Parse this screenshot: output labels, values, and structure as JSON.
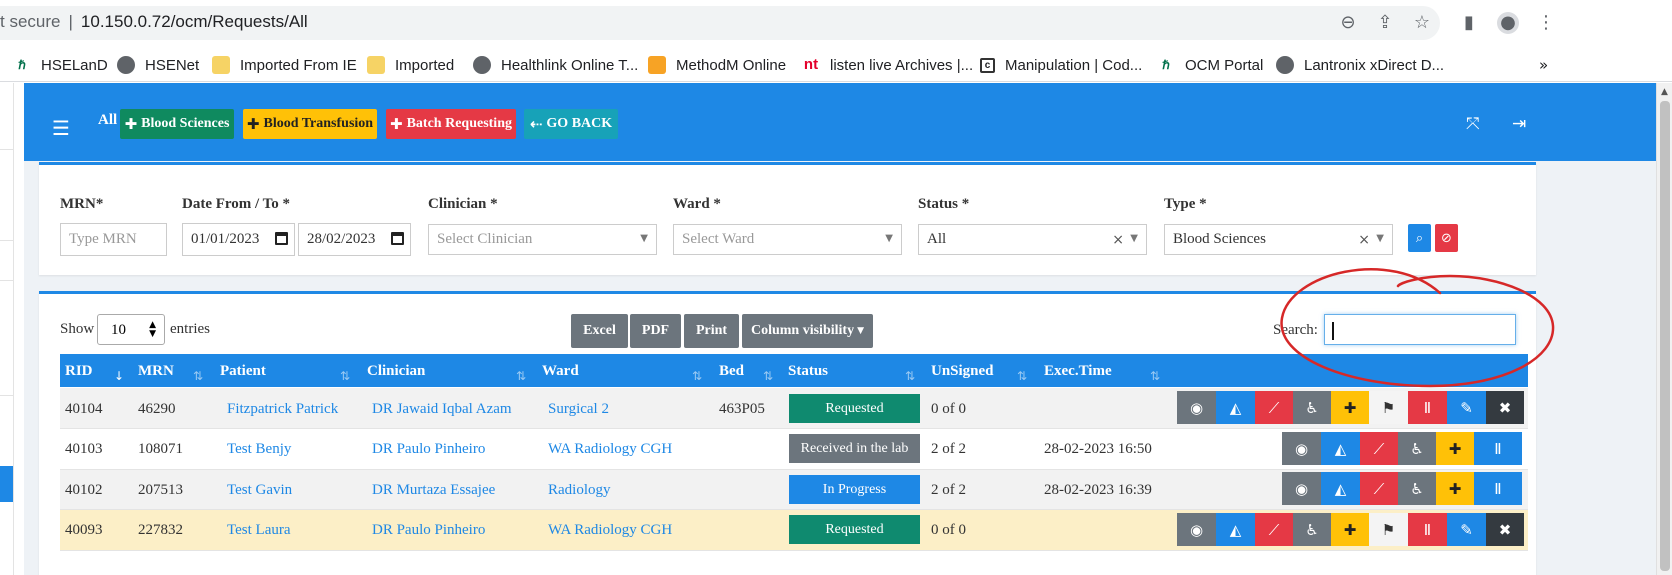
{
  "browser": {
    "security_text": "t secure",
    "url": "10.150.0.72/ocm/Requests/All"
  },
  "bookmarks": [
    {
      "label": "HSELanD",
      "icon": "hse-logo-icon",
      "icon_color": "#00704a"
    },
    {
      "label": "HSENet",
      "icon": "globe-icon",
      "icon_color": "#5f6368"
    },
    {
      "label": "Imported From IE",
      "icon": "folder-icon",
      "icon_color": "#f6d365"
    },
    {
      "label": "Imported",
      "icon": "folder-icon",
      "icon_color": "#f6d365"
    },
    {
      "label": "Healthlink Online T...",
      "icon": "globe-icon",
      "icon_color": "#5f6368"
    },
    {
      "label": "MethodM Online",
      "icon": "methodm-icon",
      "icon_color": "#f7a325"
    },
    {
      "label": "listen live Archives |...",
      "icon": "nt-logo-icon",
      "icon_color": "#e4002b"
    },
    {
      "label": "Manipulation | Cod...",
      "icon": "codepage-icon",
      "icon_color": "#333333"
    },
    {
      "label": "OCM Portal",
      "icon": "hse-logo-icon",
      "icon_color": "#00704a"
    },
    {
      "label": "Lantronix xDirect D...",
      "icon": "globe-icon",
      "icon_color": "#5f6368"
    }
  ],
  "header": {
    "filter_label": "All",
    "buttons": [
      {
        "label": "Blood Sciences",
        "color": "#0f8a5f"
      },
      {
        "label": "Blood Transfusion",
        "color": "#ffc107",
        "text_color": "#222222"
      },
      {
        "label": "Batch Requesting",
        "color": "#e53945"
      },
      {
        "label": "GO BACK",
        "color": "#17a2b8"
      }
    ]
  },
  "filters": {
    "mrn": {
      "label": "MRN*",
      "placeholder": "Type MRN"
    },
    "dates": {
      "label": "Date From / To *",
      "from": "01/01/2023",
      "to": "28/02/2023"
    },
    "clinician": {
      "label": "Clinician *",
      "placeholder": "Select Clinician"
    },
    "ward": {
      "label": "Ward *",
      "placeholder": "Select Ward"
    },
    "status": {
      "label": "Status *",
      "value": "All"
    },
    "type": {
      "label": "Type *",
      "value": "Blood Sciences"
    }
  },
  "table_controls": {
    "show_label": "Show",
    "entries_value": "10",
    "entries_label": "entries",
    "export_buttons": [
      "Excel",
      "PDF",
      "Print",
      "Column visibility"
    ],
    "search_label": "Search:"
  },
  "table": {
    "columns": [
      "RID",
      "MRN",
      "Patient",
      "Clinician",
      "Ward",
      "Bed",
      "Status",
      "UnSigned",
      "Exec.Time"
    ],
    "rows": [
      {
        "rid": "40104",
        "mrn": "46290",
        "patient": "Fitzpatrick Patrick",
        "clinician": "DR Jawaid Iqbal Azam",
        "ward": "Surgical 2",
        "bed": "463P05",
        "status": "Requested",
        "status_color": "#0f8a6f",
        "unsigned": "0 of 0",
        "exec": ""
      },
      {
        "rid": "40103",
        "mrn": "108071",
        "patient": "Test Benjy",
        "clinician": "DR Paulo Pinheiro",
        "ward": "WA Radiology CGH",
        "bed": "",
        "status": "Received in the lab",
        "status_color": "#6c757d",
        "unsigned": "2 of 2",
        "exec": "28-02-2023 16:50"
      },
      {
        "rid": "40102",
        "mrn": "207513",
        "patient": "Test Gavin",
        "clinician": "DR Murtaza Essajee",
        "ward": "Radiology",
        "bed": "",
        "status": "In Progress",
        "status_color": "#1e88e5",
        "unsigned": "2 of 2",
        "exec": "28-02-2023 16:39"
      },
      {
        "rid": "40093",
        "mrn": "227832",
        "patient": "Test Laura",
        "clinician": "DR Paulo Pinheiro",
        "ward": "WA Radiology CGH",
        "bed": "",
        "status": "Requested",
        "status_color": "#0f8a6f",
        "unsigned": "0 of 0",
        "exec": ""
      }
    ]
  },
  "action_icons": {
    "full": [
      "eye-icon",
      "area-chart-icon",
      "line-chart-icon",
      "wheelchair-icon",
      "plus-icon",
      "map-icon",
      "test-tubes-icon",
      "edit-icon",
      "close-icon"
    ],
    "short": [
      "eye-icon",
      "area-chart-icon",
      "line-chart-icon",
      "wheelchair-icon",
      "plus-icon",
      "test-tubes-icon"
    ]
  },
  "colors": {
    "primary": "#1e88e5",
    "row_highlight": "#fcefc7",
    "annotation": "#d62828"
  }
}
